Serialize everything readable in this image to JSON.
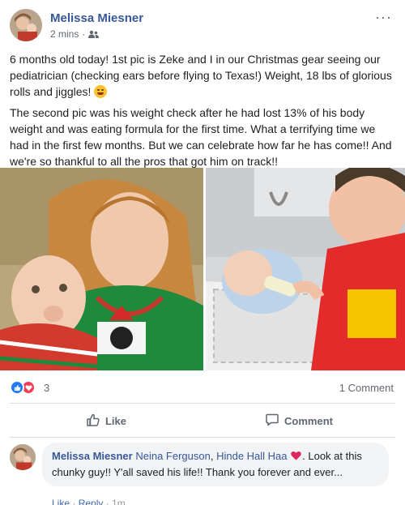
{
  "post": {
    "author": "Melissa Miesner",
    "timestamp": "2 mins",
    "separator": "·",
    "audience_icon": "friends-icon",
    "more_label": "···",
    "text_p1_before_emoji": "6 months old today! 1st pic is Zeke and I in our Christmas gear seeing our pediatrician (checking ears before flying to Texas!) Weight, 18 lbs of glorious rolls and jiggles!",
    "text_p1_emoji": "grinning-face-emoji",
    "text_p2": "The second pic was his weight check after he had lost 13% of his body weight and was eating formula for the first time. What a terrifying time we had in the first few months. But we can celebrate how far he has come!! And we're so thankful to all the pros that got him on track!!"
  },
  "engagement": {
    "reaction_icons": [
      "like-icon",
      "love-icon"
    ],
    "reaction_count": "3",
    "comment_count_label": "1 Comment"
  },
  "actions": {
    "like_label": "Like",
    "comment_label": "Comment"
  },
  "comment": {
    "author": "Melissa Miesner",
    "mention_1": "Neina Ferguson",
    "mention_sep": ", ",
    "mention_2": "Hinde Hall Haa",
    "text_after_heart": ". Look at this chunky guy!! Y'all saved his life!! Thank you forever and ever...",
    "like_link": "Like",
    "reply_link": "Reply",
    "separator": "·",
    "time": "1m"
  },
  "colors": {
    "link_blue": "#385898",
    "like_blue": "#2078f4",
    "love_red": "#f33e58",
    "muted": "#606770",
    "comment_bg": "#f2f3f5"
  }
}
